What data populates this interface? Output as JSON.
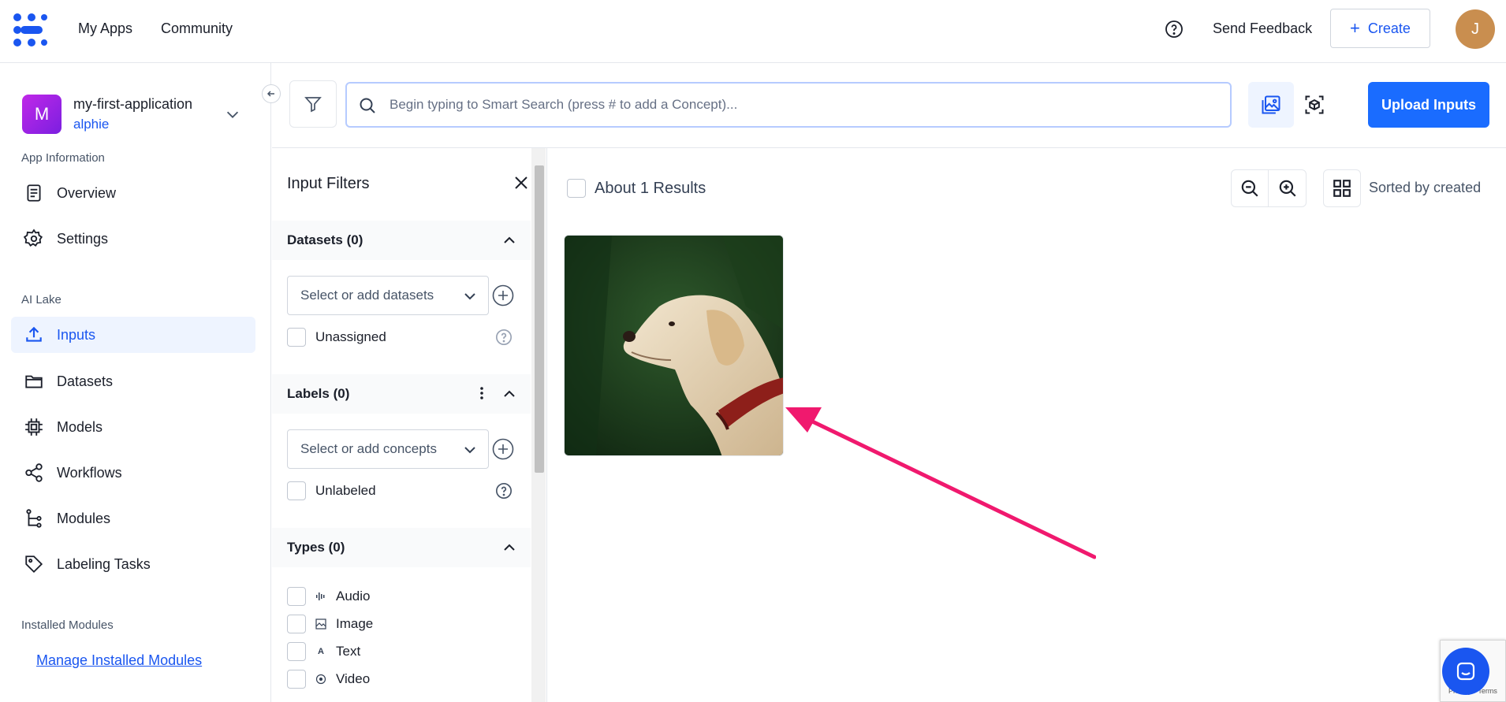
{
  "topbar": {
    "nav": [
      "My Apps",
      "Community"
    ],
    "feedback_label": "Send Feedback",
    "create_label": "Create",
    "avatar_initial": "J"
  },
  "sidebar": {
    "app_logo_letter": "M",
    "app_name": "my-first-application",
    "app_user": "alphie",
    "sections": {
      "app_info": "App Information",
      "ai_lake": "AI Lake",
      "installed": "Installed Modules"
    },
    "items": [
      {
        "label": "Overview",
        "icon": "document-icon"
      },
      {
        "label": "Settings",
        "icon": "gear-icon"
      },
      {
        "label": "Inputs",
        "icon": "upload-icon",
        "active": true
      },
      {
        "label": "Datasets",
        "icon": "folder-icon"
      },
      {
        "label": "Models",
        "icon": "chip-icon"
      },
      {
        "label": "Workflows",
        "icon": "share-icon"
      },
      {
        "label": "Modules",
        "icon": "modules-icon"
      },
      {
        "label": "Labeling Tasks",
        "icon": "tag-icon"
      }
    ],
    "manage_link": "Manage Installed Modules"
  },
  "search": {
    "placeholder": "Begin typing to Smart Search (press # to add a Concept)...",
    "upload_label": "Upload Inputs"
  },
  "filters": {
    "title": "Input Filters",
    "datasets": {
      "header": "Datasets (0)",
      "select_placeholder": "Select or add datasets",
      "checkbox_label": "Unassigned"
    },
    "labels": {
      "header": "Labels (0)",
      "select_placeholder": "Select or add concepts",
      "checkbox_label": "Unlabeled"
    },
    "types": {
      "header": "Types (0)",
      "options": [
        "Audio",
        "Image",
        "Text",
        "Video"
      ],
      "text_glyph": "A"
    }
  },
  "results": {
    "count_label": "About 1 Results",
    "sort_label": "Sorted by created"
  },
  "recaptcha": {
    "text": "Privacy - Terms"
  },
  "colors": {
    "accent": "#1a56f0",
    "upload_button": "#1a6cff",
    "annotation_arrow": "#f0196e",
    "active_item_bg": "#eef4ff"
  }
}
